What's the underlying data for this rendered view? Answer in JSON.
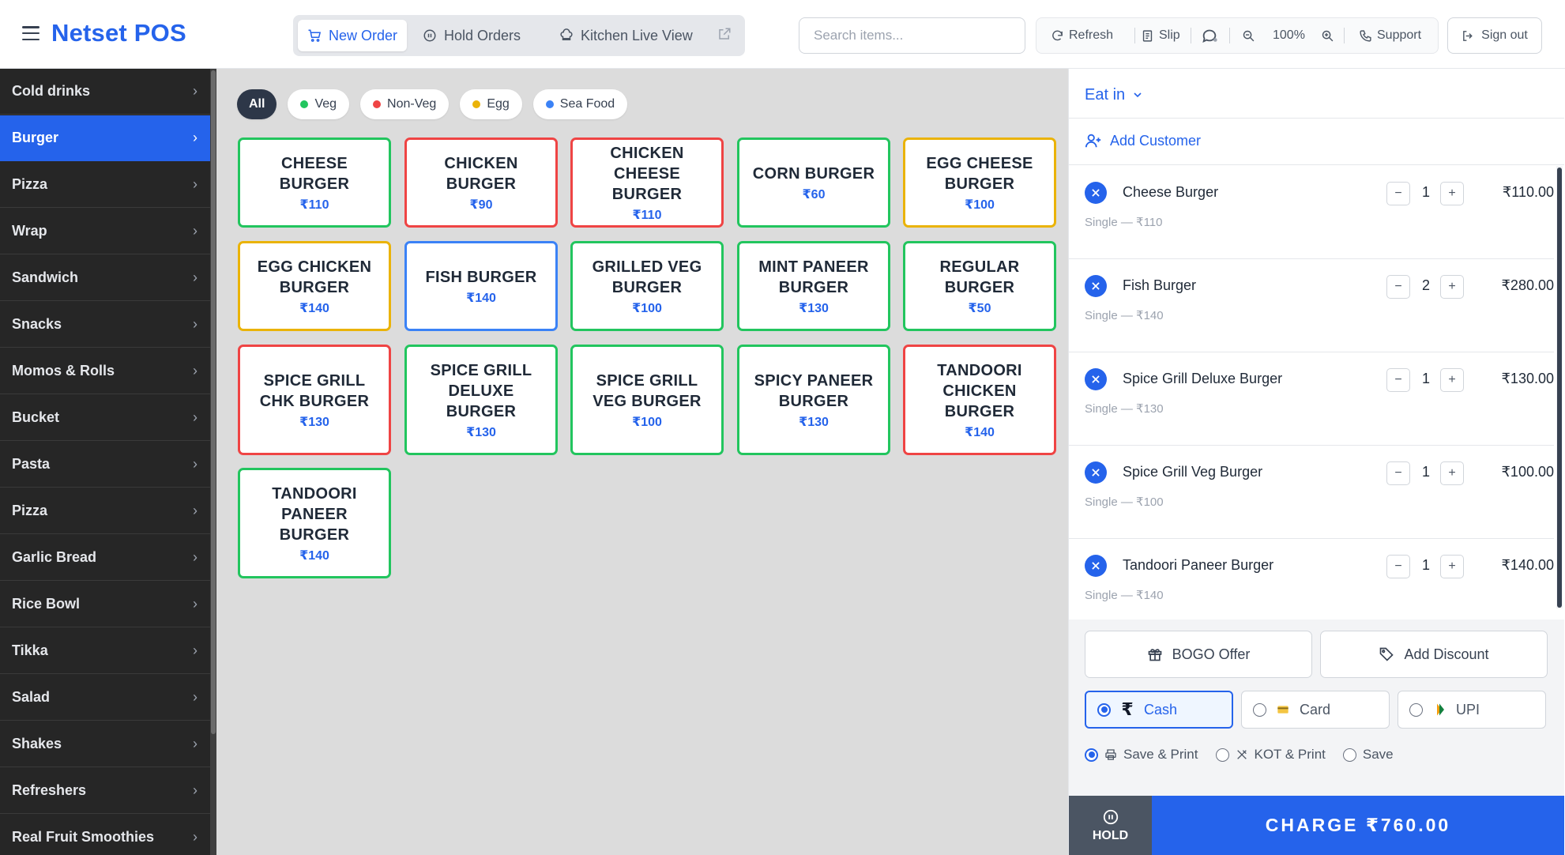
{
  "header": {
    "title": "Netset POS",
    "tabs": [
      {
        "label": "New Order",
        "icon": "cart-icon"
      },
      {
        "label": "Hold Orders",
        "icon": "pause-circle-icon"
      },
      {
        "label": "Kitchen Live View",
        "icon": "chef-hat-icon"
      }
    ],
    "search_placeholder": "Search items...",
    "toolbar": {
      "refresh": "Refresh",
      "slip": "Slip",
      "zoom": "100%",
      "support": "Support"
    },
    "signout": "Sign out"
  },
  "sidebar": {
    "categories": [
      "Cold drinks",
      "Burger",
      "Pizza",
      "Wrap",
      "Sandwich",
      "Snacks",
      "Momos & Rolls",
      "Bucket",
      "Pasta",
      "Pizza",
      "Garlic Bread",
      "Rice Bowl",
      "Tikka",
      "Salad",
      "Shakes",
      "Refreshers",
      "Real Fruit Smoothies"
    ],
    "active_index": 1
  },
  "filters": [
    {
      "label": "All"
    },
    {
      "label": "Veg",
      "color": "#22c55e"
    },
    {
      "label": "Non-Veg",
      "color": "#ef4444"
    },
    {
      "label": "Egg",
      "color": "#eab308"
    },
    {
      "label": "Sea Food",
      "color": "#3b82f6"
    }
  ],
  "menu_items": [
    {
      "name": "CHEESE BURGER",
      "price": "₹110",
      "type": "veg"
    },
    {
      "name": "CHICKEN BURGER",
      "price": "₹90",
      "type": "nonveg"
    },
    {
      "name": "CHICKEN CHEESE BURGER",
      "price": "₹110",
      "type": "nonveg"
    },
    {
      "name": "CORN BURGER",
      "price": "₹60",
      "type": "veg"
    },
    {
      "name": "EGG CHEESE BURGER",
      "price": "₹100",
      "type": "egg"
    },
    {
      "name": "EGG CHICKEN BURGER",
      "price": "₹140",
      "type": "egg"
    },
    {
      "name": "FISH BURGER",
      "price": "₹140",
      "type": "seafood"
    },
    {
      "name": "GRILLED VEG BURGER",
      "price": "₹100",
      "type": "veg"
    },
    {
      "name": "MINT PANEER BURGER",
      "price": "₹130",
      "type": "veg"
    },
    {
      "name": "REGULAR BURGER",
      "price": "₹50",
      "type": "veg"
    },
    {
      "name": "SPICE GRILL CHK BURGER",
      "price": "₹130",
      "type": "nonveg"
    },
    {
      "name": "SPICE GRILL DELUXE BURGER",
      "price": "₹130",
      "type": "veg"
    },
    {
      "name": "SPICE GRILL VEG BURGER",
      "price": "₹100",
      "type": "veg"
    },
    {
      "name": "SPICY PANEER BURGER",
      "price": "₹130",
      "type": "veg"
    },
    {
      "name": "TANDOORI CHICKEN BURGER",
      "price": "₹140",
      "type": "nonveg"
    },
    {
      "name": "TANDOORI PANEER BURGER",
      "price": "₹140",
      "type": "veg"
    }
  ],
  "type_colors": {
    "veg": "#22c55e",
    "nonveg": "#ef4444",
    "egg": "#eab308",
    "seafood": "#3b82f6"
  },
  "order": {
    "mode": "Eat in",
    "add_customer": "Add Customer",
    "lines": [
      {
        "name": "Cheese Burger",
        "sub": "Single — ₹110",
        "qty": "1",
        "total": "₹110.00"
      },
      {
        "name": "Fish Burger",
        "sub": "Single — ₹140",
        "qty": "2",
        "total": "₹280.00"
      },
      {
        "name": "Spice Grill Deluxe Burger",
        "sub": "Single — ₹130",
        "qty": "1",
        "total": "₹130.00"
      },
      {
        "name": "Spice Grill Veg Burger",
        "sub": "Single — ₹100",
        "qty": "1",
        "total": "₹100.00"
      },
      {
        "name": "Tandoori Paneer Burger",
        "sub": "Single — ₹140",
        "qty": "1",
        "total": "₹140.00"
      }
    ],
    "bogo_offer": "BOGO Offer",
    "add_discount": "Add Discount",
    "payment_methods": [
      {
        "label": "Cash",
        "selected": true
      },
      {
        "label": "Card",
        "selected": false
      },
      {
        "label": "UPI",
        "selected": false
      }
    ],
    "print_options": [
      {
        "label": "Save & Print",
        "selected": true
      },
      {
        "label": "KOT & Print",
        "selected": false
      },
      {
        "label": "Save",
        "selected": false
      }
    ],
    "hold_label": "HOLD",
    "charge_label": "CHARGE ₹760.00"
  },
  "accent_color": "#2563eb"
}
